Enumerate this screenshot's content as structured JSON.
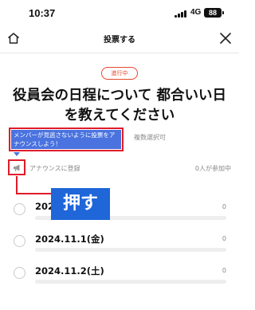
{
  "status_bar": {
    "time": "10:37",
    "network": "4G",
    "battery": "88"
  },
  "nav": {
    "title": "投票する"
  },
  "poll": {
    "status_badge": "進行中",
    "title": "役員会の日程について 都合いい日を教えてください",
    "tooltip": "メンバーが見逃さないように投票をアナウンスしよう！",
    "multi_select": "複数選択可",
    "announce_label": "アナウンスに登録",
    "participants": "0人が参加中",
    "options": [
      {
        "label": "2024.",
        "count": "0"
      },
      {
        "label": "2024.11.1(金)",
        "count": "0"
      },
      {
        "label": "2024.11.2(土)",
        "count": "0"
      }
    ]
  },
  "annotation": {
    "label": "押す"
  },
  "colors": {
    "accent": "#e8482d",
    "highlight": "#e01c2a",
    "tooltip": "#4a73e0",
    "overlay": "#1f66d9"
  }
}
